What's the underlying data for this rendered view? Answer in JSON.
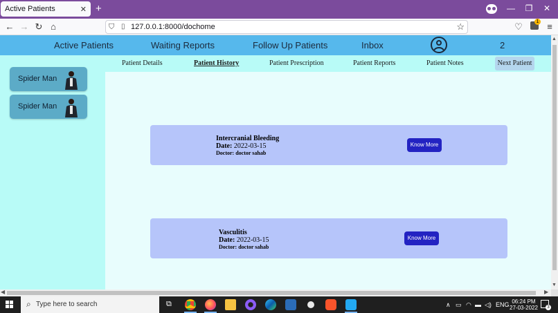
{
  "browser": {
    "tab_title": "Active Patients",
    "tab_close": "✕",
    "new_tab": "+",
    "url": "127.0.0.1:8000/dochome",
    "extension_badge": "1"
  },
  "header": {
    "nav": [
      "Active Patients",
      "Waiting Reports",
      "Follow Up Patients",
      "Inbox"
    ],
    "count": "2"
  },
  "sidebar": {
    "patients": [
      {
        "name": "Spider Man"
      },
      {
        "name": "Spider Man"
      }
    ]
  },
  "tabs": {
    "items": [
      "Patient Details",
      "Patient History",
      "Patient Prescription",
      "Patient Reports",
      "Patient Notes"
    ],
    "active": "Patient History",
    "next_label": "Next Patient"
  },
  "history": [
    {
      "title": "Intercranial Bleeding",
      "date_label": "Date:",
      "date": "2022-03-15",
      "doctor": "Doctor: doctor sahab",
      "button": "Know More"
    },
    {
      "title": "Vasculitis",
      "date_label": "Date:",
      "date": "2022-03-15",
      "doctor": "Doctor: doctor sahab",
      "button": "Know More"
    }
  ],
  "taskbar": {
    "search_placeholder": "Type here to search",
    "language": "ENG",
    "time": "06:24 PM",
    "date": "27-03-2022",
    "notifications": "3"
  }
}
